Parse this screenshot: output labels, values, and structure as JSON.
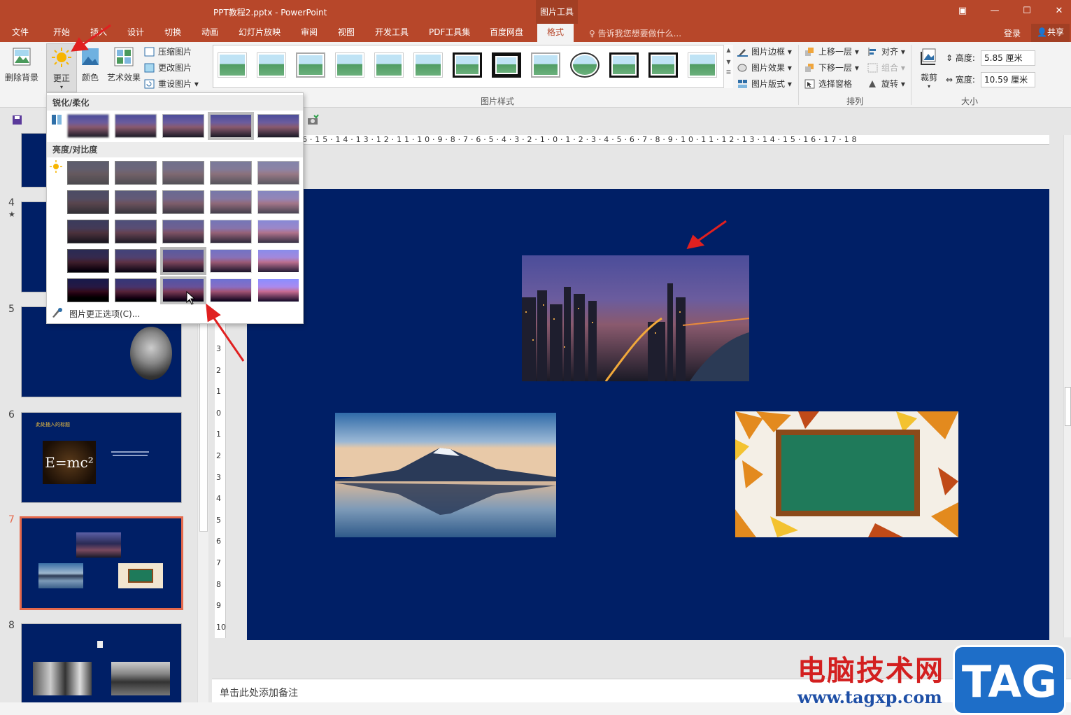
{
  "window": {
    "title": "PPT教程2.pptx - PowerPoint",
    "context_tool": "图片工具"
  },
  "tabs": [
    "文件",
    "开始",
    "插入",
    "设计",
    "切换",
    "动画",
    "幻灯片放映",
    "审阅",
    "视图",
    "开发工具",
    "PDF工具集",
    "百度网盘",
    "格式"
  ],
  "active_tab": "格式",
  "tell_me": "告诉我您想要做什么...",
  "login": "登录",
  "share": "共享",
  "ribbon": {
    "remove_bg": "删除背景",
    "corrections": "更正",
    "color": "颜色",
    "artistic": "艺术效果",
    "compress": "压缩图片",
    "change_pic": "更改图片",
    "reset_pic": "重设图片",
    "picture_border": "图片边框",
    "picture_effects": "图片效果",
    "picture_layout": "图片版式",
    "picture_styles_label": "图片样式",
    "bring_forward": "上移一层",
    "send_backward": "下移一层",
    "selection_pane": "选择窗格",
    "align": "对齐",
    "group": "组合",
    "rotate": "旋转",
    "arrange_label": "排列",
    "crop": "裁剪",
    "height_label": "高度:",
    "height_value": "5.85 厘米",
    "width_label": "宽度:",
    "width_value": "10.59 厘米",
    "size_label": "大小"
  },
  "dropdown": {
    "section1": "锐化/柔化",
    "section2": "亮度/对比度",
    "footer": "图片更正选项(C)..."
  },
  "thumbnails": [
    {
      "num": "4",
      "star": "★"
    },
    {
      "num": "5"
    },
    {
      "num": "6",
      "title": "此处插入的标题",
      "formula": "E=mc²"
    },
    {
      "num": "7"
    },
    {
      "num": "8"
    }
  ],
  "ruler_h": "6·15·14·13·12·11·10·9·8·7·6·5·4·3·2·1·0·1·2·3·4·5·6·7·8·9·10·11·12·13·14·15·16·17·18",
  "ruler_v": [
    "3",
    "2",
    "1",
    "0",
    "1",
    "2",
    "3",
    "4",
    "5",
    "6",
    "7",
    "8",
    "9",
    "10"
  ],
  "notes": "单击此处添加备注",
  "watermark": {
    "text": "电脑技术网",
    "url": "www.tagxp.com",
    "tag": "TAG"
  },
  "colors": {
    "accent": "#b7472a",
    "slide_bg": "#001f66",
    "selection": "#e5694c"
  }
}
